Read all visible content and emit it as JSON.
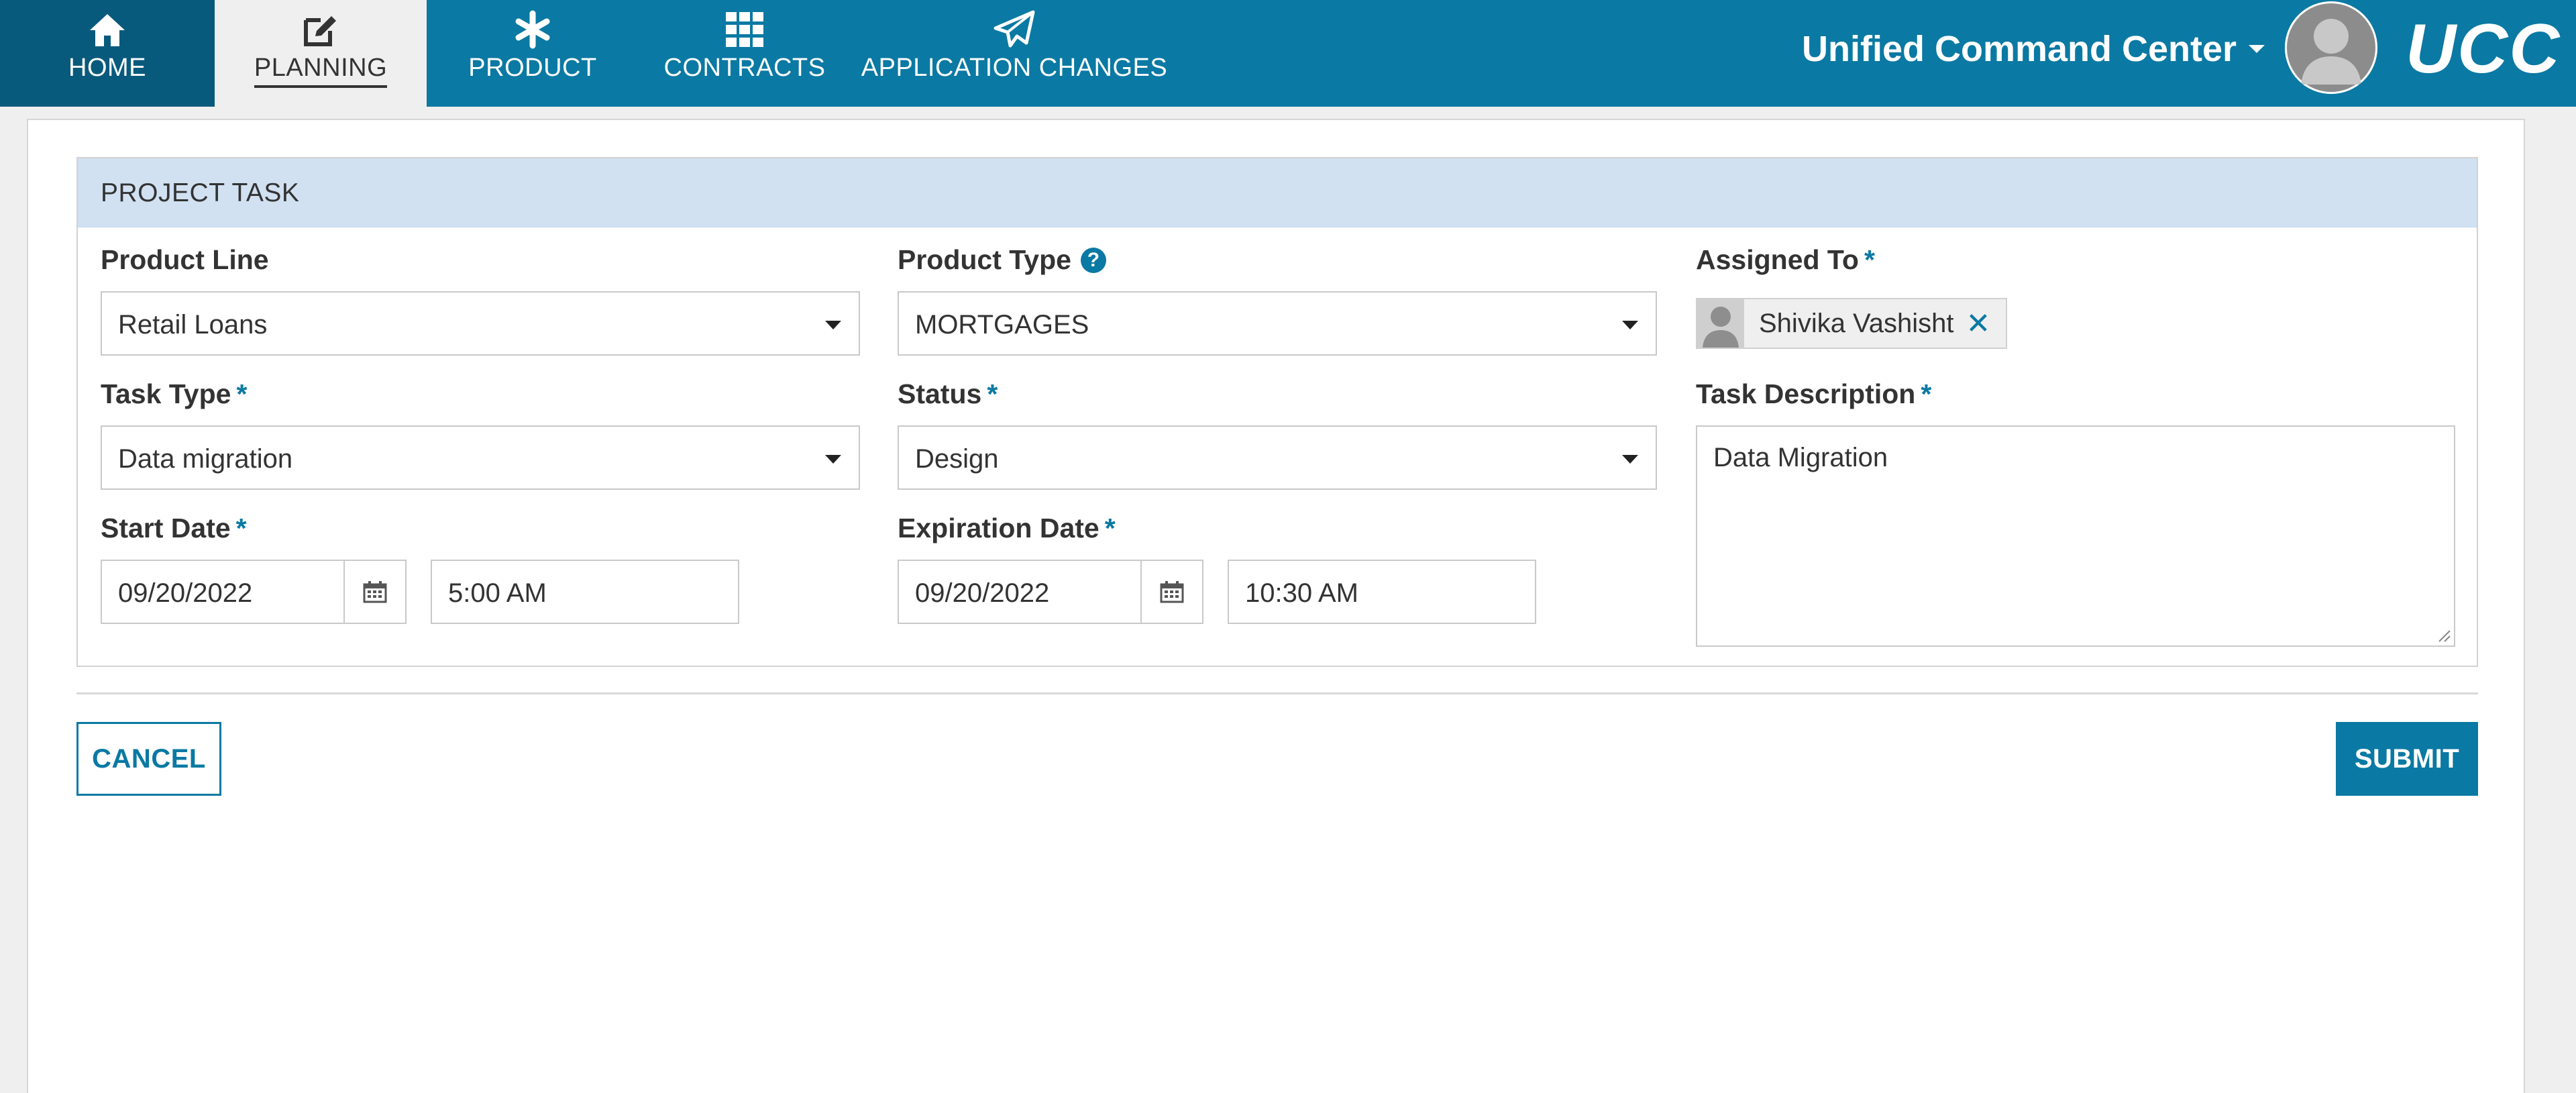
{
  "nav": {
    "tabs": [
      {
        "label": "HOME",
        "icon": "home-icon"
      },
      {
        "label": "PLANNING",
        "icon": "edit-icon",
        "active": true
      },
      {
        "label": "PRODUCT",
        "icon": "asterisk-icon"
      },
      {
        "label": "CONTRACTS",
        "icon": "grid-icon"
      },
      {
        "label": "APPLICATION CHANGES",
        "icon": "paper-plane-icon"
      }
    ],
    "app_menu_label": "Unified Command Center",
    "logo_text": "UCC"
  },
  "form": {
    "section_title": "PROJECT TASK",
    "product_line": {
      "label": "Product Line",
      "value": "Retail Loans"
    },
    "product_type": {
      "label": "Product Type",
      "value": "MORTGAGES"
    },
    "assigned_to": {
      "label": "Assigned To",
      "required_mark": "*",
      "user": "Shivika Vashisht"
    },
    "task_type": {
      "label": "Task Type",
      "required_mark": "*",
      "value": "Data migration"
    },
    "status": {
      "label": "Status",
      "required_mark": "*",
      "value": "Design"
    },
    "task_description": {
      "label": "Task Description",
      "required_mark": "*",
      "value": "Data Migration"
    },
    "start_date": {
      "label": "Start Date",
      "required_mark": "*",
      "date": "09/20/2022",
      "time": "5:00 AM"
    },
    "expiration_date": {
      "label": "Expiration Date",
      "required_mark": "*",
      "date": "09/20/2022",
      "time": "10:30 AM"
    }
  },
  "actions": {
    "cancel_label": "CANCEL",
    "submit_label": "SUBMIT"
  },
  "colors": {
    "primary": "#0a79a3",
    "nav_active_dark": "#085a7c",
    "section_header_bg": "#d1e1f2",
    "page_bg": "#efefef"
  }
}
